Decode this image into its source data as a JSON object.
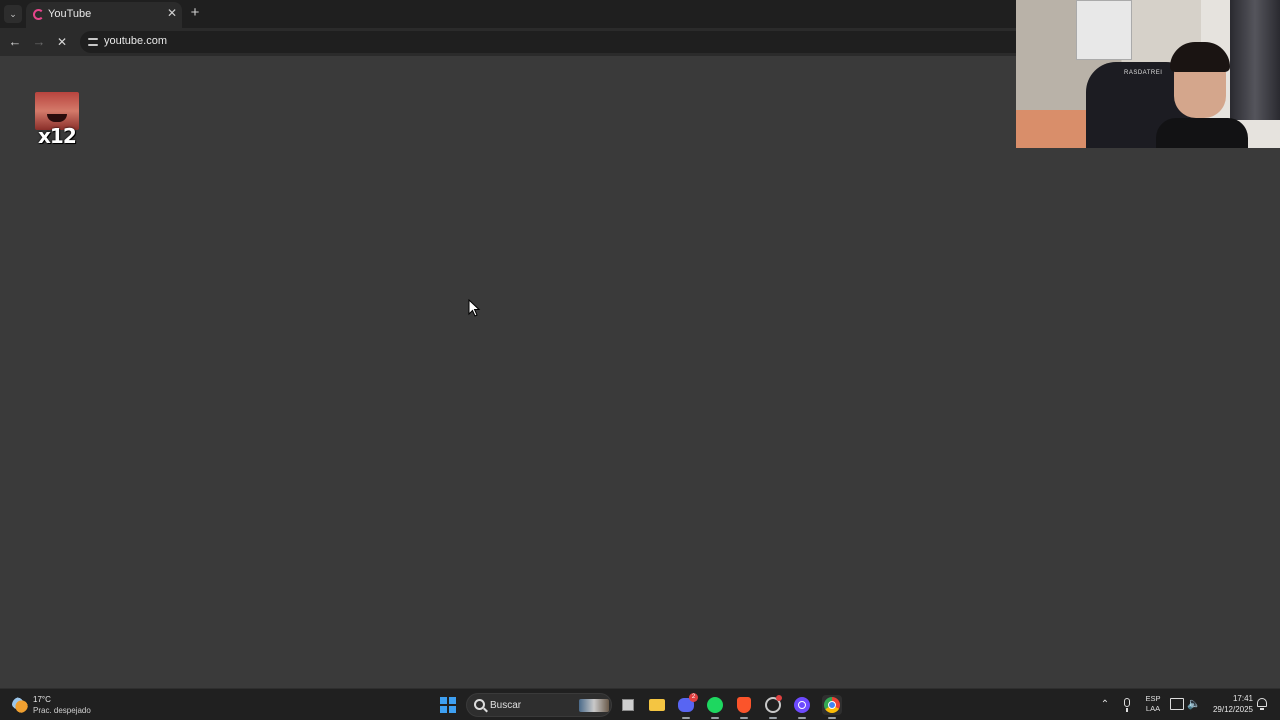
{
  "browser": {
    "tab": {
      "title": "YouTube",
      "favicon": "youtube-loading-icon"
    },
    "new_tab_label": "+",
    "address": {
      "url": "youtube.com"
    },
    "icons": {
      "tab_search": "chevron-down-icon",
      "back": "back-arrow-icon",
      "forward": "forward-arrow-icon",
      "stop": "stop-loading-icon",
      "site_info": "site-info-icon"
    }
  },
  "overlay": {
    "emote_count": "x12"
  },
  "webcam": {
    "chair_label": "RASDATREI"
  },
  "taskbar": {
    "weather": {
      "temp": "17°C",
      "desc": "Prac. despejado"
    },
    "search_placeholder": "Buscar",
    "discord_badge": "2",
    "lang": {
      "line1": "ESP",
      "line2": "LAA"
    },
    "clock": {
      "time": "17:41",
      "date": "29/12/2025"
    },
    "apps": [
      "task-view",
      "file-explorer",
      "discord",
      "spotify",
      "brave",
      "steam",
      "proton",
      "chrome"
    ]
  },
  "colors": {
    "page_bg": "#3a3a3a",
    "tabstrip_bg": "#1f1f1f",
    "toolbar_bg": "#2b2b2b",
    "taskbar_bg": "#202020",
    "windows_blue": "#3ea0f2"
  }
}
